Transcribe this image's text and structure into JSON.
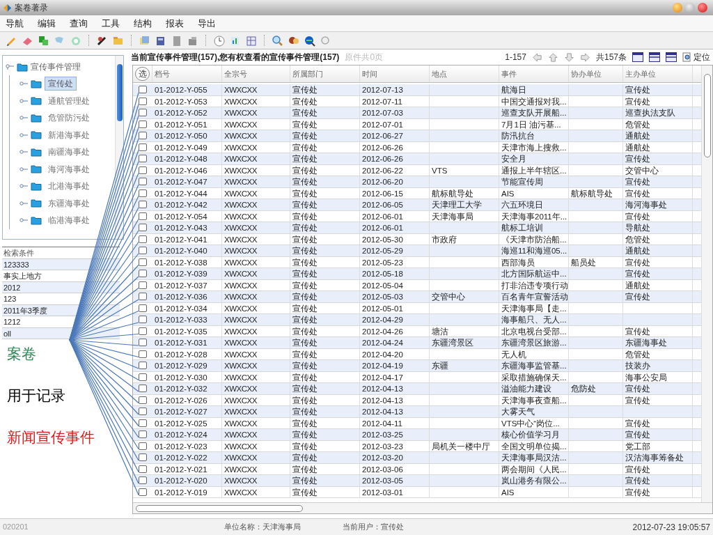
{
  "window": {
    "title": "案卷著录"
  },
  "menu": [
    "导航",
    "编辑",
    "查询",
    "工具",
    "结构",
    "报表",
    "导出"
  ],
  "tree": {
    "label": "宣传事件管理",
    "expanded": true,
    "children": [
      {
        "label": "宣传处",
        "selected": true
      },
      {
        "label": "通航管理处",
        "selected": false
      },
      {
        "label": "危管防污处",
        "selected": false
      },
      {
        "label": "新港海事处",
        "selected": false
      },
      {
        "label": "南疆海事处",
        "selected": false
      },
      {
        "label": "海河海事处",
        "selected": false
      },
      {
        "label": "北港海事处",
        "selected": false
      },
      {
        "label": "东疆海事处",
        "selected": false
      },
      {
        "label": "临港海事处",
        "selected": false
      }
    ]
  },
  "search_conditions": {
    "title": "检索条件",
    "items": [
      "123333",
      "事实上地方",
      "2012",
      "123",
      "2011年3季度",
      "1212",
      "oll"
    ]
  },
  "annotations": [
    {
      "text": "案卷",
      "color": "#2e8b57"
    },
    {
      "text": "用于记录",
      "color": "#000000"
    },
    {
      "text": "新闻宣传事件",
      "color": "#d42020"
    }
  ],
  "list_header": {
    "title": "当前宣传事件管理(157),您有权查看的宣传事件管理(157)",
    "pages_note": "原件共0页",
    "range": "1-157",
    "total": "共157条",
    "locate_label": "定位"
  },
  "table": {
    "select_all_label": "选",
    "columns": [
      "档号",
      "全宗号",
      "所属部门",
      "时间",
      "地点",
      "事件",
      "协办单位",
      "主办单位"
    ],
    "rows": [
      {
        "checked": false,
        "cells": [
          "01-2012-Y-055",
          "XWXCXX",
          "宣传处",
          "2012-07-13",
          "",
          "航海日",
          "",
          "宣传处"
        ]
      },
      {
        "checked": false,
        "cells": [
          "01-2012-Y-053",
          "XWXCXX",
          "宣传处",
          "2012-07-11",
          "",
          "中国交通报对我...",
          "",
          "宣传处"
        ]
      },
      {
        "checked": false,
        "cells": [
          "01-2012-Y-052",
          "XWXCXX",
          "宣传处",
          "2012-07-03",
          "",
          "巡查支队开展船...",
          "",
          "巡查执法支队"
        ]
      },
      {
        "checked": false,
        "cells": [
          "01-2012-Y-051",
          "XWXCXX",
          "宣传处",
          "2012-07-01",
          "",
          "7月1日 油污基...",
          "",
          "危管处"
        ]
      },
      {
        "checked": false,
        "cells": [
          "01-2012-Y-050",
          "XWXCXX",
          "宣传处",
          "2012-06-27",
          "",
          "防汛抗台",
          "",
          "通航处"
        ]
      },
      {
        "checked": false,
        "cells": [
          "01-2012-Y-049",
          "XWXCXX",
          "宣传处",
          "2012-06-26",
          "",
          "天津市海上搜救...",
          "",
          "通航处"
        ]
      },
      {
        "checked": false,
        "cells": [
          "01-2012-Y-048",
          "XWXCXX",
          "宣传处",
          "2012-06-26",
          "",
          "安全月",
          "",
          "宣传处"
        ]
      },
      {
        "checked": false,
        "cells": [
          "01-2012-Y-046",
          "XWXCXX",
          "宣传处",
          "2012-06-22",
          "VTS",
          "通报上半年辖区...",
          "",
          "交管中心"
        ]
      },
      {
        "checked": false,
        "cells": [
          "01-2012-Y-047",
          "XWXCXX",
          "宣传处",
          "2012-06-20",
          "",
          "节能宣传周",
          "",
          "宣传处"
        ]
      },
      {
        "checked": false,
        "cells": [
          "01-2012-Y-044",
          "XWXCXX",
          "宣传处",
          "2012-06-15",
          "航标航导处",
          "AIS",
          "航标航导处",
          "宣传处"
        ]
      },
      {
        "checked": false,
        "cells": [
          "01-2012-Y-042",
          "XWXCXX",
          "宣传处",
          "2012-06-05",
          "天津理工大学",
          "六五环境日",
          "",
          "海河海事处"
        ]
      },
      {
        "checked": false,
        "cells": [
          "01-2012-Y-054",
          "XWXCXX",
          "宣传处",
          "2012-06-01",
          "天津海事局",
          "天津海事2011年...",
          "",
          "宣传处"
        ]
      },
      {
        "checked": false,
        "cells": [
          "01-2012-Y-043",
          "XWXCXX",
          "宣传处",
          "2012-06-01",
          "",
          "航标工培训",
          "",
          "导航处"
        ]
      },
      {
        "checked": false,
        "cells": [
          "01-2012-Y-041",
          "XWXCXX",
          "宣传处",
          "2012-05-30",
          "市政府",
          "《天津市防治船...",
          "",
          "危管处"
        ]
      },
      {
        "checked": false,
        "cells": [
          "01-2012-Y-040",
          "XWXCXX",
          "宣传处",
          "2012-05-29",
          "",
          "海巡11和海巡05...",
          "",
          "通航处"
        ]
      },
      {
        "checked": false,
        "cells": [
          "01-2012-Y-038",
          "XWXCXX",
          "宣传处",
          "2012-05-23",
          "",
          "西部海员",
          "船员处",
          "宣传处"
        ]
      },
      {
        "checked": false,
        "cells": [
          "01-2012-Y-039",
          "XWXCXX",
          "宣传处",
          "2012-05-18",
          "",
          "北方国际航运中...",
          "",
          "宣传处"
        ]
      },
      {
        "checked": false,
        "cells": [
          "01-2012-Y-037",
          "XWXCXX",
          "宣传处",
          "2012-05-04",
          "",
          "打非治违专项行动",
          "",
          "通航处"
        ]
      },
      {
        "checked": false,
        "cells": [
          "01-2012-Y-036",
          "XWXCXX",
          "宣传处",
          "2012-05-03",
          "交管中心",
          "百名青年宣誓活动",
          "",
          "宣传处"
        ]
      },
      {
        "checked": false,
        "cells": [
          "01-2012-Y-034",
          "XWXCXX",
          "宣传处",
          "2012-05-01",
          "",
          "天津海事局【走...",
          "",
          ""
        ]
      },
      {
        "checked": false,
        "cells": [
          "01-2012-Y-033",
          "XWXCXX",
          "宣传处",
          "2012-04-29",
          "",
          "海事船只、无人...",
          "",
          ""
        ]
      },
      {
        "checked": false,
        "cells": [
          "01-2012-Y-035",
          "XWXCXX",
          "宣传处",
          "2012-04-26",
          "塘沽",
          "北京电视台受部...",
          "",
          "宣传处"
        ]
      },
      {
        "checked": false,
        "cells": [
          "01-2012-Y-031",
          "XWXCXX",
          "宣传处",
          "2012-04-24",
          "东疆湾景区",
          "东疆湾景区旅游...",
          "",
          "东疆海事处"
        ]
      },
      {
        "checked": false,
        "cells": [
          "01-2012-Y-028",
          "XWXCXX",
          "宣传处",
          "2012-04-20",
          "",
          "无人机",
          "",
          "危管处"
        ]
      },
      {
        "checked": false,
        "cells": [
          "01-2012-Y-029",
          "XWXCXX",
          "宣传处",
          "2012-04-19",
          "东疆",
          "东疆海事监管基...",
          "",
          "技装办"
        ]
      },
      {
        "checked": false,
        "cells": [
          "01-2012-Y-030",
          "XWXCXX",
          "宣传处",
          "2012-04-17",
          "",
          "采取措施确保天...",
          "",
          "海事公安局"
        ]
      },
      {
        "checked": false,
        "cells": [
          "01-2012-Y-032",
          "XWXCXX",
          "宣传处",
          "2012-04-13",
          "",
          "溢油能力建设",
          "危防处",
          "宣传处"
        ]
      },
      {
        "checked": false,
        "cells": [
          "01-2012-Y-026",
          "XWXCXX",
          "宣传处",
          "2012-04-13",
          "",
          "天津海事夜查船...",
          "",
          "宣传处"
        ]
      },
      {
        "checked": false,
        "cells": [
          "01-2012-Y-027",
          "XWXCXX",
          "宣传处",
          "2012-04-13",
          "",
          "大雾天气",
          "",
          ""
        ]
      },
      {
        "checked": false,
        "cells": [
          "01-2012-Y-025",
          "XWXCXX",
          "宣传处",
          "2012-04-11",
          "",
          "VTS中心“岗位...",
          "",
          "宣传处"
        ]
      },
      {
        "checked": false,
        "cells": [
          "01-2012-Y-024",
          "XWXCXX",
          "宣传处",
          "2012-03-25",
          "",
          "核心价值学习月",
          "",
          "宣传处"
        ]
      },
      {
        "checked": false,
        "cells": [
          "01-2012-Y-023",
          "XWXCXX",
          "宣传处",
          "2012-03-23",
          "局机关一楼中厅",
          "全国文明单位揭...",
          "",
          "党工部"
        ]
      },
      {
        "checked": false,
        "cells": [
          "01-2012-Y-022",
          "XWXCXX",
          "宣传处",
          "2012-03-20",
          "",
          "天津海事局汉沽...",
          "",
          "汉沽海事筹备处"
        ]
      },
      {
        "checked": false,
        "cells": [
          "01-2012-Y-021",
          "XWXCXX",
          "宣传处",
          "2012-03-06",
          "",
          "两会期间《人民...",
          "",
          "宣传处"
        ]
      },
      {
        "checked": false,
        "cells": [
          "01-2012-Y-020",
          "XWXCXX",
          "宣传处",
          "2012-03-05",
          "",
          "岚山港务有限公...",
          "",
          "宣传处"
        ]
      },
      {
        "checked": false,
        "cells": [
          "01-2012-Y-019",
          "XWXCXX",
          "宣传处",
          "2012-03-01",
          "",
          "AIS",
          "",
          "宣传处"
        ]
      }
    ]
  },
  "status_bar": {
    "code": "020201",
    "unit": "单位名称：天津海事局",
    "user": "当前用户：宣传处",
    "datetime": "2012-07-23 19:05:57"
  }
}
